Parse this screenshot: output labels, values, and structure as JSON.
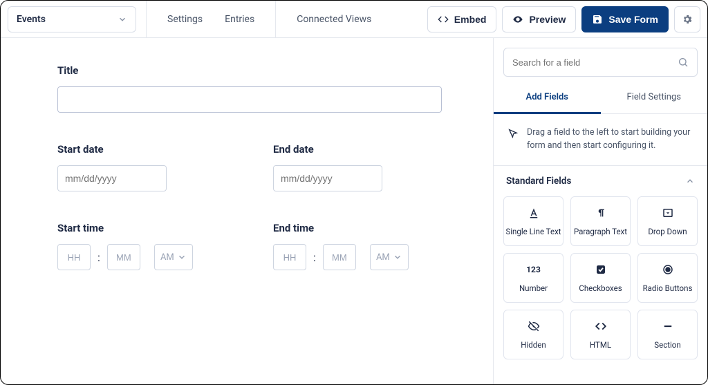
{
  "header": {
    "form_select_label": "Events",
    "links": {
      "settings": "Settings",
      "entries": "Entries",
      "connected_views": "Connected Views"
    },
    "embed": "Embed",
    "preview": "Preview",
    "save": "Save Form"
  },
  "canvas": {
    "title_label": "Title",
    "title_value": "",
    "start_date_label": "Start date",
    "start_date_placeholder": "mm/dd/yyyy",
    "end_date_label": "End date",
    "end_date_placeholder": "mm/dd/yyyy",
    "start_time_label": "Start time",
    "end_time_label": "End time",
    "hh": "HH",
    "mm": "MM",
    "ampm": "AM"
  },
  "side": {
    "search_placeholder": "Search for a field",
    "tab_add": "Add Fields",
    "tab_settings": "Field Settings",
    "hint": "Drag a field to the left to start building your form and then start configuring it.",
    "group_title": "Standard Fields",
    "fields": [
      {
        "label": "Single Line Text"
      },
      {
        "label": "Paragraph Text"
      },
      {
        "label": "Drop Down"
      },
      {
        "label": "Number"
      },
      {
        "label": "Checkboxes"
      },
      {
        "label": "Radio Buttons"
      },
      {
        "label": "Hidden"
      },
      {
        "label": "HTML"
      },
      {
        "label": "Section"
      }
    ],
    "number_icon_text": "123"
  }
}
